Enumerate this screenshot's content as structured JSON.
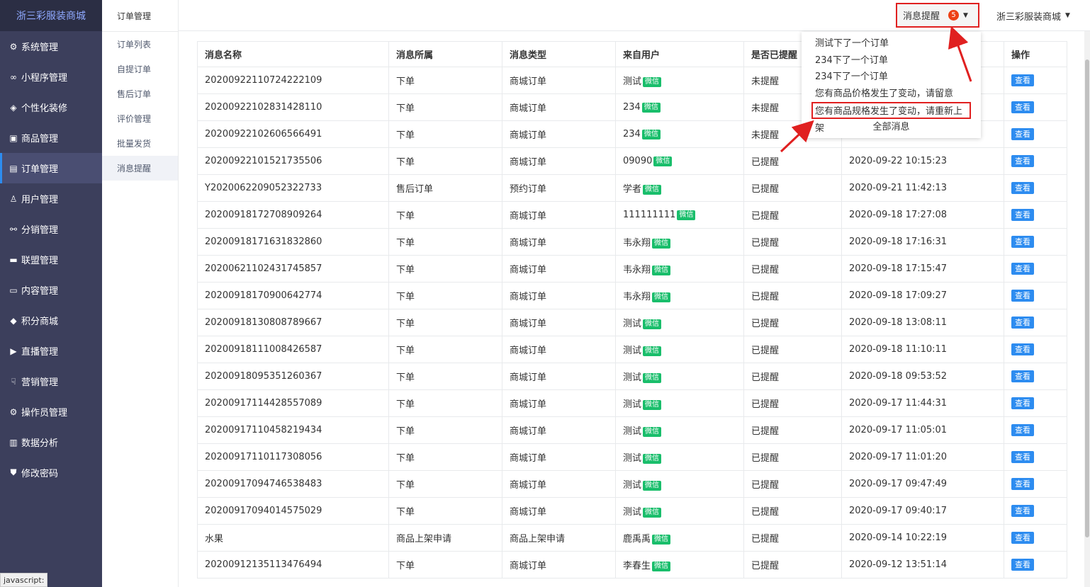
{
  "brand": "浙三彩服装商城",
  "menu": [
    {
      "icon": "gear-icon",
      "glyph": "⚙",
      "label": "系统管理"
    },
    {
      "icon": "link-icon",
      "glyph": "∞",
      "label": "小程序管理"
    },
    {
      "icon": "diamond-icon",
      "glyph": "◈",
      "label": "个性化装修"
    },
    {
      "icon": "bag-icon",
      "glyph": "▣",
      "label": "商品管理"
    },
    {
      "icon": "list-icon",
      "glyph": "▤",
      "label": "订单管理"
    },
    {
      "icon": "user-icon",
      "glyph": "♙",
      "label": "用户管理"
    },
    {
      "icon": "network-icon",
      "glyph": "⚯",
      "label": "分销管理"
    },
    {
      "icon": "card-icon",
      "glyph": "▬",
      "label": "联盟管理"
    },
    {
      "icon": "doc-icon",
      "glyph": "▭",
      "label": "内容管理"
    },
    {
      "icon": "cube-icon",
      "glyph": "◆",
      "label": "积分商城"
    },
    {
      "icon": "play-icon",
      "glyph": "▶",
      "label": "直播管理"
    },
    {
      "icon": "hand-icon",
      "glyph": "☟",
      "label": "营销管理"
    },
    {
      "icon": "cog-icon",
      "glyph": "⚙",
      "label": "操作员管理"
    },
    {
      "icon": "chart-icon",
      "glyph": "▥",
      "label": "数据分析"
    },
    {
      "icon": "shield-icon",
      "glyph": "⛊",
      "label": "修改密码"
    }
  ],
  "active_menu": "订单管理",
  "sub": {
    "title": "订单管理",
    "items": [
      "订单列表",
      "自提订单",
      "售后订单",
      "评价管理",
      "批量发货",
      "消息提醒"
    ]
  },
  "topbar": {
    "notice_label": "消息提醒",
    "notice_count": "5",
    "user_label": "浙三彩服装商城"
  },
  "dropdown": {
    "items": [
      "测试下了一个订单",
      "234下了一个订单",
      "234下了一个订单",
      "您有商品价格发生了变动，请留意",
      "您有商品规格发生了变动，请重新上架"
    ],
    "all_label": "全部消息"
  },
  "table": {
    "headers": [
      "消息名称",
      "消息所属",
      "消息类型",
      "来自用户",
      "是否已提醒",
      "",
      "操作"
    ],
    "wx_label": "微信",
    "view_label": "查看",
    "rows": [
      [
        "20200922110724222109",
        "下单",
        "商城订单",
        "测试",
        "未提醒",
        ""
      ],
      [
        "20200922102831428110",
        "下单",
        "商城订单",
        "234",
        "未提醒",
        ""
      ],
      [
        "20200922102606566491",
        "下单",
        "商城订单",
        "234",
        "未提醒",
        ""
      ],
      [
        "20200922101521735506",
        "下单",
        "商城订单",
        "09090",
        "已提醒",
        "2020-09-22 10:15:23"
      ],
      [
        "Y2020062209052322733",
        "售后订单",
        "预约订单",
        "学者",
        "已提醒",
        "2020-09-21 11:42:13"
      ],
      [
        "20200918172708909264",
        "下单",
        "商城订单",
        "111111111",
        "已提醒",
        "2020-09-18 17:27:08"
      ],
      [
        "20200918171631832860",
        "下单",
        "商城订单",
        "韦永翔",
        "已提醒",
        "2020-09-18 17:16:31"
      ],
      [
        "20200621102431745857",
        "下单",
        "商城订单",
        "韦永翔",
        "已提醒",
        "2020-09-18 17:15:47"
      ],
      [
        "20200918170900642774",
        "下单",
        "商城订单",
        "韦永翔",
        "已提醒",
        "2020-09-18 17:09:27"
      ],
      [
        "20200918130808789667",
        "下单",
        "商城订单",
        "测试",
        "已提醒",
        "2020-09-18 13:08:11"
      ],
      [
        "20200918111008426587",
        "下单",
        "商城订单",
        "测试",
        "已提醒",
        "2020-09-18 11:10:11"
      ],
      [
        "20200918095351260367",
        "下单",
        "商城订单",
        "测试",
        "已提醒",
        "2020-09-18 09:53:52"
      ],
      [
        "20200917114428557089",
        "下单",
        "商城订单",
        "测试",
        "已提醒",
        "2020-09-17 11:44:31"
      ],
      [
        "20200917110458219434",
        "下单",
        "商城订单",
        "测试",
        "已提醒",
        "2020-09-17 11:05:01"
      ],
      [
        "20200917110117308056",
        "下单",
        "商城订单",
        "测试",
        "已提醒",
        "2020-09-17 11:01:20"
      ],
      [
        "20200917094746538483",
        "下单",
        "商城订单",
        "测试",
        "已提醒",
        "2020-09-17 09:47:49"
      ],
      [
        "20200917094014575029",
        "下单",
        "商城订单",
        "测试",
        "已提醒",
        "2020-09-17 09:40:17"
      ],
      [
        "水果",
        "商品上架申请",
        "商品上架申请",
        "鹿禹禹",
        "已提醒",
        "2020-09-14 10:22:19"
      ],
      [
        "20200912135113476494",
        "下单",
        "商城订单",
        "李春生",
        "已提醒",
        "2020-09-12 13:51:14"
      ]
    ]
  },
  "status_tip": "javascript:",
  "accent_color": "#2d8cf0",
  "annotation_color": "#e02020"
}
